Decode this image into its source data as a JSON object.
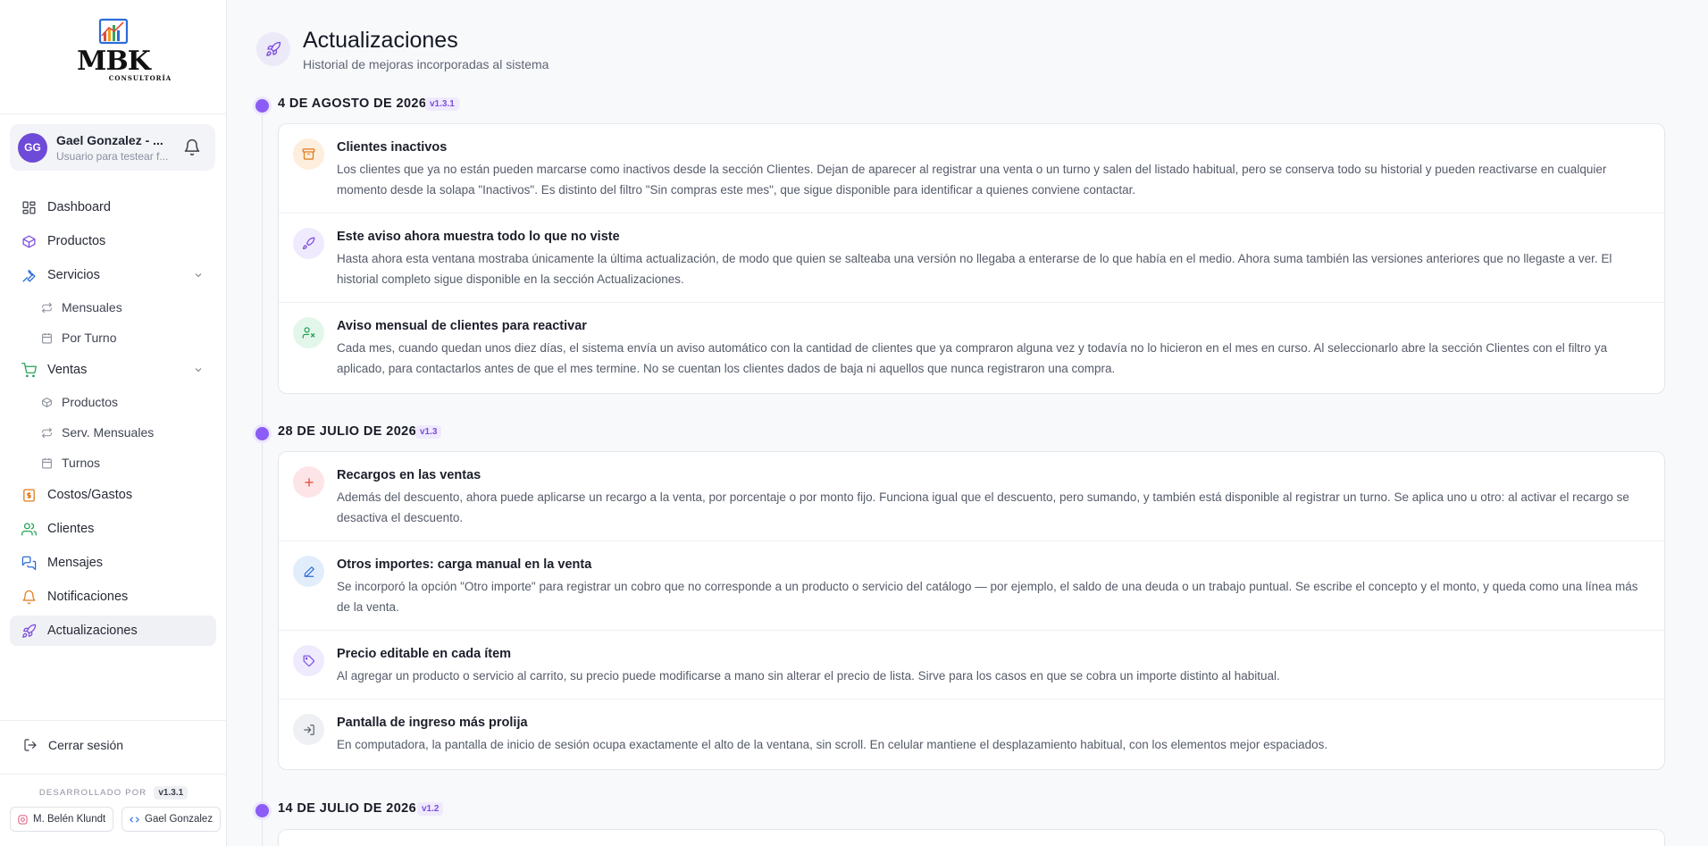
{
  "brand": {
    "name": "MBK",
    "tagline": "CONSULTORÍA"
  },
  "user": {
    "initials": "GG",
    "name": "Gael Gonzalez - ...",
    "role": "Usuario para testear f..."
  },
  "nav": {
    "dashboard": "Dashboard",
    "productos": "Productos",
    "servicios": "Servicios",
    "servicios_sub": [
      "Mensuales",
      "Por Turno"
    ],
    "ventas": "Ventas",
    "ventas_sub": [
      "Productos",
      "Serv. Mensuales",
      "Turnos"
    ],
    "costos": "Costos/Gastos",
    "clientes": "Clientes",
    "mensajes": "Mensajes",
    "notificaciones": "Notificaciones",
    "actualizaciones": "Actualizaciones"
  },
  "footer": {
    "logout": "Cerrar sesión",
    "developed_by": "DESARROLLADO POR",
    "version": "v1.3.1",
    "dev1": "M. Belén Klundt",
    "dev2": "Gael Gonzalez"
  },
  "page": {
    "title": "Actualizaciones",
    "subtitle": "Historial de mejoras incorporadas al sistema"
  },
  "releases": [
    {
      "date": "4 DE AGOSTO DE 2026",
      "version": "v1.3.1",
      "entries": [
        {
          "icon": "archive-icon",
          "title": "Clientes inactivos",
          "text": "Los clientes que ya no están pueden marcarse como inactivos desde la sección Clientes. Dejan de aparecer al registrar una venta o un turno y salen del listado habitual, pero se conserva todo su historial y pueden reactivarse en cualquier momento desde la solapa \"Inactivos\". Es distinto del filtro \"Sin compras este mes\", que sigue disponible para identificar a quienes conviene contactar."
        },
        {
          "icon": "rocket-icon",
          "title": "Este aviso ahora muestra todo lo que no viste",
          "text": "Hasta ahora esta ventana mostraba únicamente la última actualización, de modo que quien se salteaba una versión no llegaba a enterarse de lo que había en el medio. Ahora suma también las versiones anteriores que no llegaste a ver. El historial completo sigue disponible en la sección Actualizaciones."
        },
        {
          "icon": "user-x-icon",
          "title": "Aviso mensual de clientes para reactivar",
          "text": "Cada mes, cuando quedan unos diez días, el sistema envía un aviso automático con la cantidad de clientes que ya compraron alguna vez y todavía no lo hicieron en el mes en curso. Al seleccionarlo abre la sección Clientes con el filtro ya aplicado, para contactarlos antes de que el mes termine. No se cuentan los clientes dados de baja ni aquellos que nunca registraron una compra."
        }
      ]
    },
    {
      "date": "28 DE JULIO DE 2026",
      "version": "v1.3",
      "entries": [
        {
          "icon": "plus-icon",
          "title": "Recargos en las ventas",
          "text": "Además del descuento, ahora puede aplicarse un recargo a la venta, por porcentaje o por monto fijo. Funciona igual que el descuento, pero sumando, y también está disponible al registrar un turno. Se aplica uno u otro: al activar el recargo se desactiva el descuento."
        },
        {
          "icon": "pencil-icon",
          "title": "Otros importes: carga manual en la venta",
          "text": "Se incorporó la opción \"Otro importe\" para registrar un cobro que no corresponde a un producto o servicio del catálogo — por ejemplo, el saldo de una deuda o un trabajo puntual. Se escribe el concepto y el monto, y queda como una línea más de la venta."
        },
        {
          "icon": "tag-icon",
          "title": "Precio editable en cada ítem",
          "text": "Al agregar un producto o servicio al carrito, su precio puede modificarse a mano sin alterar el precio de lista. Sirve para los casos en que se cobra un importe distinto al habitual."
        },
        {
          "icon": "login-icon",
          "title": "Pantalla de ingreso más prolija",
          "text": "En computadora, la pantalla de inicio de sesión ocupa exactamente el alto de la ventana, sin scroll. En celular mantiene el desplazamiento habitual, con los elementos mejor espaciados."
        }
      ]
    },
    {
      "date": "14 DE JULIO DE 2026",
      "version": "v1.2",
      "entries": []
    }
  ],
  "colors": {
    "accent": "#8b5cf6",
    "avatar": "#6d4ad8"
  }
}
